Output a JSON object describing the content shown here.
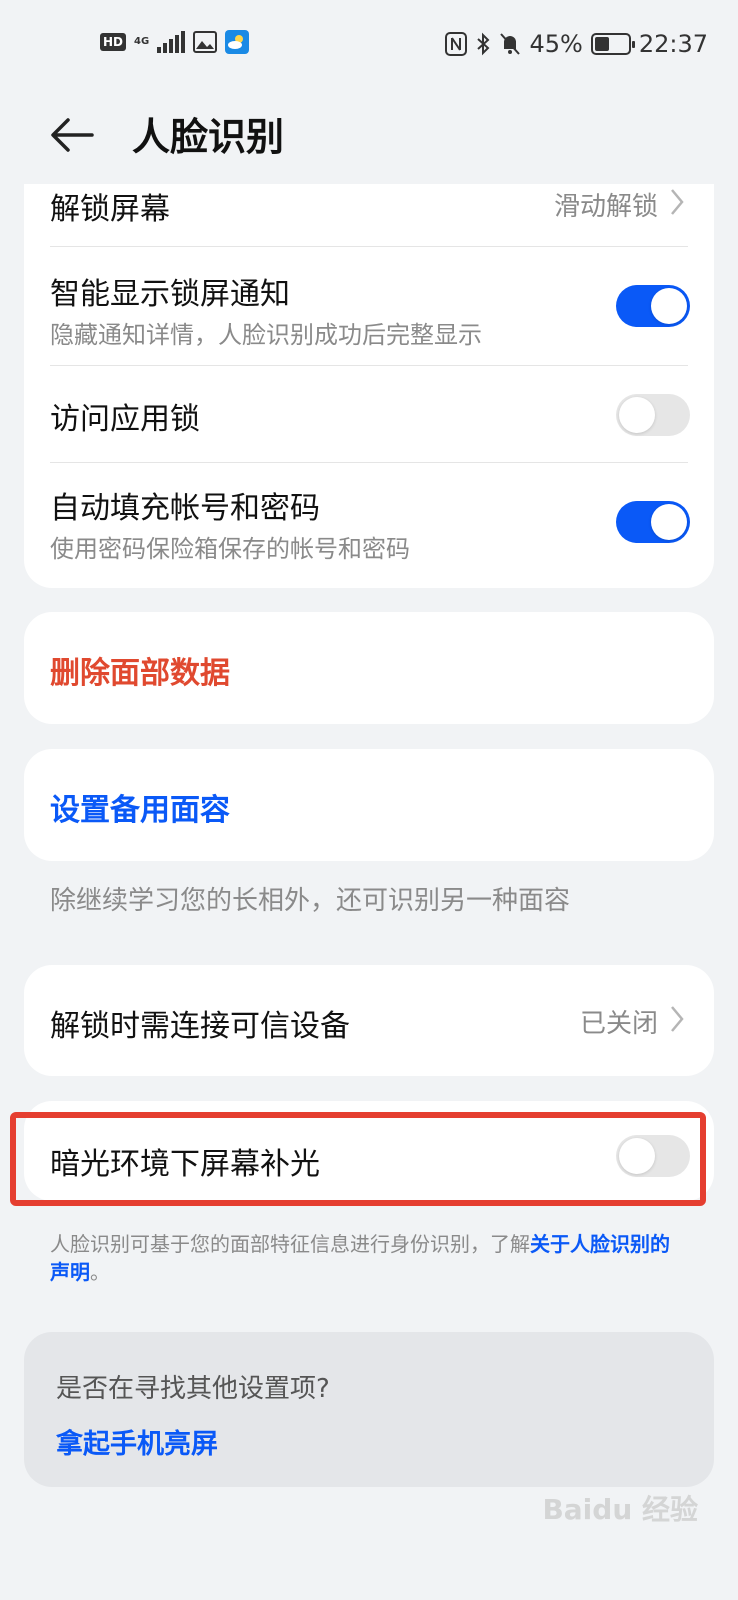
{
  "status_bar": {
    "hd": "HD",
    "network": "4G",
    "battery_text": "45%",
    "battery_level": 0.45,
    "time": "22:37"
  },
  "header": {
    "title": "人脸识别"
  },
  "main_card": {
    "unlock": {
      "title": "解锁屏幕",
      "value": "滑动解锁"
    },
    "smart_notify": {
      "title": "智能显示锁屏通知",
      "subtitle": "隐藏通知详情，人脸识别成功后完整显示",
      "enabled": true
    },
    "app_lock": {
      "title": "访问应用锁",
      "enabled": false
    },
    "autofill": {
      "title": "自动填充帐号和密码",
      "subtitle": "使用密码保险箱保存的帐号和密码",
      "enabled": true
    }
  },
  "delete_card": {
    "label": "删除面部数据",
    "color": "#e0492f"
  },
  "alt_face_card": {
    "label": "设置备用面容",
    "color": "#0a59f7"
  },
  "alt_face_note": "除继续学习您的长相外，还可识别另一种面容",
  "trusted_device": {
    "title": "解锁时需连接可信设备",
    "value": "已关闭"
  },
  "dim_light": {
    "title": "暗光环境下屏幕补光",
    "enabled": false
  },
  "disclaimer": {
    "text": "人脸识别可基于您的面部特征信息进行身份识别，了解",
    "link_part1": "关于人脸识别的",
    "link_part2": "声明",
    "end": "。"
  },
  "suggest_card": {
    "question": "是否在寻找其他设置项?",
    "link": "拿起手机亮屏"
  },
  "watermark": "Baidu 经验"
}
